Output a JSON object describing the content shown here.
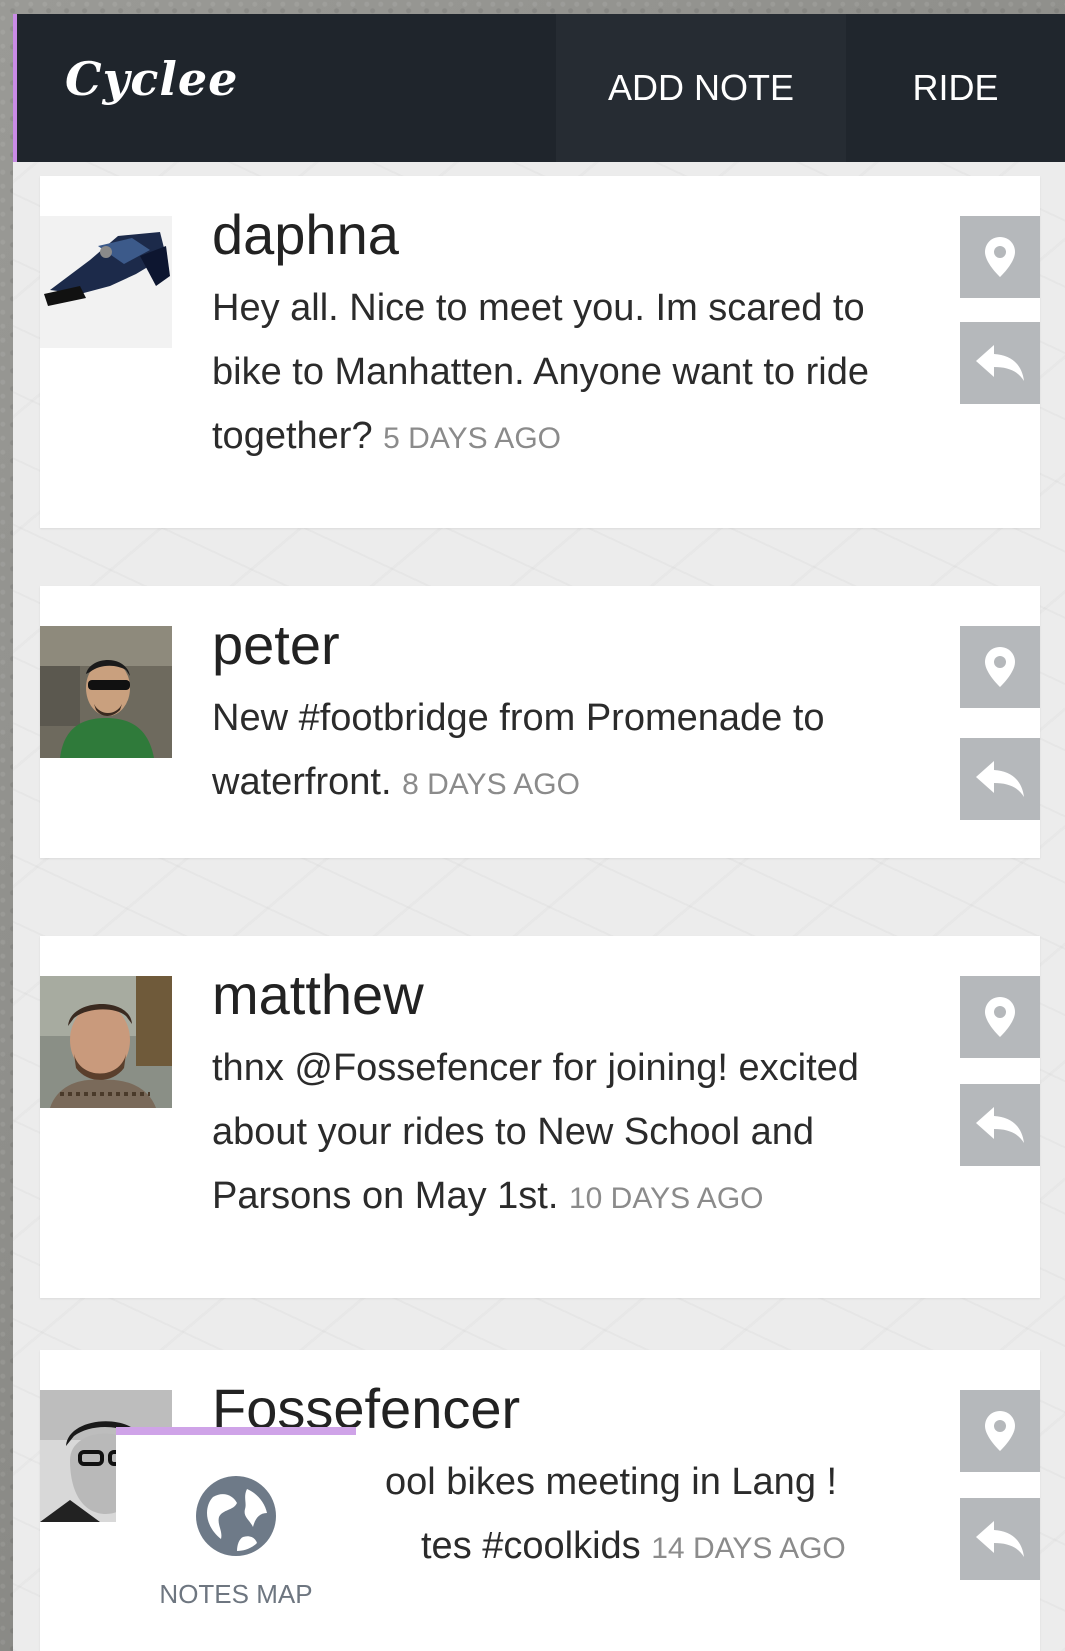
{
  "app": {
    "title": "Cyclee"
  },
  "nav": {
    "add_note": "ADD NOTE",
    "ride": "RIDE"
  },
  "notes": [
    {
      "user": "daphna",
      "text": "Hey all. Nice to meet you. Im scared to bike to Manhatten. Anyone want to ride together?",
      "ago": "5 DAYS AGO"
    },
    {
      "user": "peter",
      "text": "New #footbridge from Promenade to waterfront.",
      "ago": "8 DAYS AGO"
    },
    {
      "user": "matthew",
      "text": "thnx @Fossefencer for joining! excited about your rides to New School and Parsons on May 1st.",
      "ago": "10 DAYS AGO"
    },
    {
      "user": "Fossefencer",
      "text": "ool bikes meeting in Lang ! ",
      "text_line2": "tes #coolkids",
      "ago": "14 DAYS AGO"
    }
  ],
  "notes_map": {
    "label": "NOTES MAP"
  },
  "icons": {
    "location": "map-pin-icon",
    "reply": "reply-arrow-icon",
    "globe": "globe-icon"
  },
  "colors": {
    "header_bg": "#1f252c",
    "accent": "#c98be6",
    "action_btn": "#b5b8bb"
  }
}
